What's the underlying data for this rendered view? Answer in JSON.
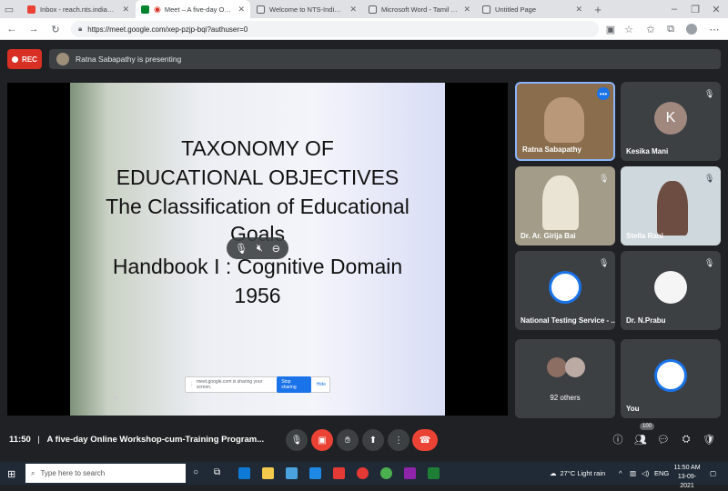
{
  "browser": {
    "tabs": [
      {
        "title": "Inbox - reach.nts.india@ciil-ntsi...",
        "active": false,
        "favicon_color": "#ea4335"
      },
      {
        "title": "Meet – A five-day Online W...",
        "active": true,
        "favicon_color": "#00832d"
      },
      {
        "title": "Welcome to NTS-India Website",
        "active": false,
        "favicon_color": "#5f6368"
      },
      {
        "title": "Microsoft Word - Tamil Time Tab...",
        "active": false,
        "favicon_color": "#5f6368"
      },
      {
        "title": "Untitled Page",
        "active": false,
        "favicon_color": "#5f6368"
      }
    ],
    "url": "https://meet.google.com/xep-pzjp-bqi?authuser=0"
  },
  "meet": {
    "rec_label": "REC",
    "presenting_text": "Ratna Sabapathy is presenting",
    "slide_lines": [
      "TAXONOMY OF",
      "EDUCATIONAL OBJECTIVES",
      "The Classification of Educational",
      "Goals",
      "Handbook I : Cognitive Domain",
      "1956"
    ],
    "share_bar": {
      "text": "meet.google.com is sharing your screen.",
      "stop_label": "Stop sharing",
      "hide_label": "Hide"
    },
    "participants": [
      {
        "name": "Ratna Sabapathy",
        "type": "video",
        "muted": false
      },
      {
        "name": "Kesika Mani",
        "type": "letter",
        "letter": "K",
        "muted": true
      },
      {
        "name": "Dr. Ar. Girija Bai",
        "type": "video",
        "muted": true
      },
      {
        "name": "Stella Rani",
        "type": "video",
        "muted": true
      },
      {
        "name": "National Testing Service - ...",
        "type": "logo",
        "muted": true
      },
      {
        "name": "Dr. N.Prabu",
        "type": "photo",
        "muted": true
      },
      {
        "name": "92 others",
        "type": "group",
        "muted": false
      },
      {
        "name": "You",
        "type": "logo",
        "muted": false
      }
    ],
    "bottom": {
      "time": "11:50",
      "separator": "|",
      "meeting_title": "A five-day Online Workshop-cum-Training Program...",
      "people_count": "100"
    }
  },
  "taskbar": {
    "search_placeholder": "Type here to search",
    "weather": "27°C  Light rain",
    "lang": "ENG",
    "clock_time": "11:50 AM",
    "clock_date": "13-09-2021"
  },
  "colors": {
    "rec": "#d93025",
    "end_call": "#ea4335",
    "active_tile_border": "#8ab4f8",
    "accent": "#1a73e8"
  }
}
